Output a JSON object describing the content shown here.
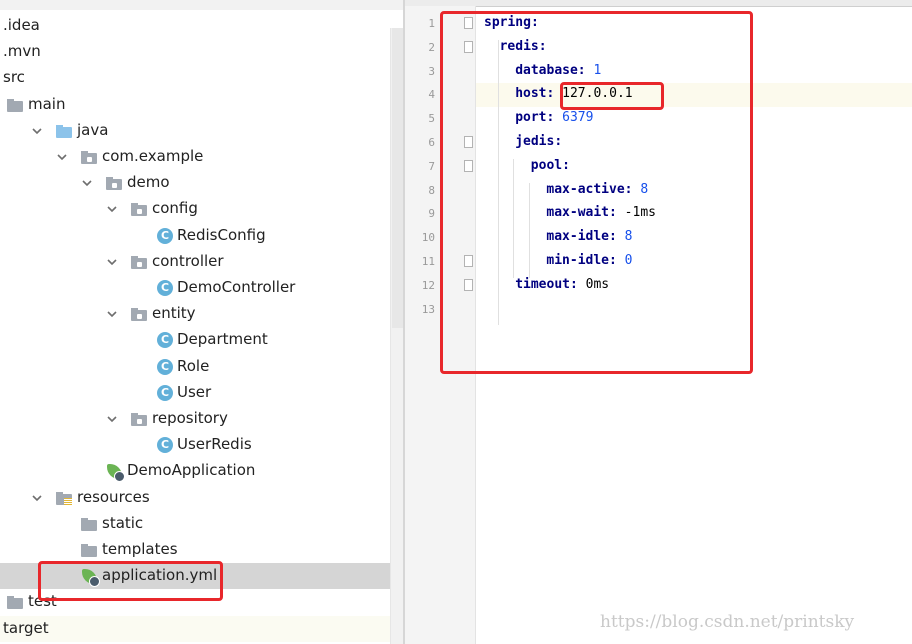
{
  "project_tree": {
    "items": [
      {
        "label": ".idea",
        "indent": 0,
        "icon": "none",
        "arrow": "none"
      },
      {
        "label": ".mvn",
        "indent": 0,
        "icon": "none",
        "arrow": "none"
      },
      {
        "label": "src",
        "indent": 0,
        "icon": "none",
        "arrow": "none"
      },
      {
        "label": "main",
        "indent": 0,
        "icon": "folder",
        "arrow": "none"
      },
      {
        "label": "java",
        "indent": 1,
        "icon": "folder-blue",
        "arrow": "down"
      },
      {
        "label": "com.example",
        "indent": 2,
        "icon": "package",
        "arrow": "down"
      },
      {
        "label": "demo",
        "indent": 3,
        "icon": "package",
        "arrow": "down"
      },
      {
        "label": "config",
        "indent": 4,
        "icon": "package",
        "arrow": "down"
      },
      {
        "label": "RedisConfig",
        "indent": 5,
        "icon": "class",
        "arrow": "none"
      },
      {
        "label": "controller",
        "indent": 4,
        "icon": "package",
        "arrow": "down"
      },
      {
        "label": "DemoController",
        "indent": 5,
        "icon": "class",
        "arrow": "none"
      },
      {
        "label": "entity",
        "indent": 4,
        "icon": "package",
        "arrow": "down"
      },
      {
        "label": "Department",
        "indent": 5,
        "icon": "class",
        "arrow": "none"
      },
      {
        "label": "Role",
        "indent": 5,
        "icon": "class",
        "arrow": "none"
      },
      {
        "label": "User",
        "indent": 5,
        "icon": "class",
        "arrow": "none"
      },
      {
        "label": "repository",
        "indent": 4,
        "icon": "package",
        "arrow": "down"
      },
      {
        "label": "UserRedis",
        "indent": 5,
        "icon": "class",
        "arrow": "none"
      },
      {
        "label": "DemoApplication",
        "indent": 3,
        "icon": "spring-boot",
        "arrow": "none"
      },
      {
        "label": "resources",
        "indent": 1,
        "icon": "resources-folder",
        "arrow": "down"
      },
      {
        "label": "static",
        "indent": 2,
        "icon": "folder",
        "arrow": "none"
      },
      {
        "label": "templates",
        "indent": 2,
        "icon": "folder",
        "arrow": "none"
      },
      {
        "label": "application.yml",
        "indent": 2,
        "icon": "spring-config",
        "arrow": "none",
        "selected": true
      },
      {
        "label": "test",
        "indent": 0,
        "icon": "folder",
        "arrow": "none"
      },
      {
        "label": "target",
        "indent": 0,
        "icon": "none",
        "arrow": "none",
        "hover": true
      }
    ]
  },
  "editor": {
    "current_line": 4,
    "lines": [
      {
        "num": "1",
        "level": 0,
        "key": "spring:",
        "value": "",
        "fold": "open"
      },
      {
        "num": "2",
        "level": 1,
        "key": "redis:",
        "value": "",
        "fold": "open"
      },
      {
        "num": "3",
        "level": 2,
        "key": "database:",
        "value": "1",
        "fold": ""
      },
      {
        "num": "4",
        "level": 2,
        "key": "host:",
        "value": "127.0.0.1",
        "fold": ""
      },
      {
        "num": "5",
        "level": 2,
        "key": "port:",
        "value": "6379",
        "fold": ""
      },
      {
        "num": "6",
        "level": 2,
        "key": "jedis:",
        "value": "",
        "fold": "open"
      },
      {
        "num": "7",
        "level": 3,
        "key": "pool:",
        "value": "",
        "fold": "open"
      },
      {
        "num": "8",
        "level": 4,
        "key": "max-active:",
        "value": "8",
        "fold": ""
      },
      {
        "num": "9",
        "level": 4,
        "key": "max-wait:",
        "value": "-1ms",
        "fold": ""
      },
      {
        "num": "10",
        "level": 4,
        "key": "max-idle:",
        "value": "8",
        "fold": ""
      },
      {
        "num": "11",
        "level": 4,
        "key": "min-idle:",
        "value": "0",
        "fold": "close"
      },
      {
        "num": "12",
        "level": 2,
        "key": "timeout:",
        "value": "0ms",
        "fold": "close"
      },
      {
        "num": "13",
        "level": 0,
        "key": "",
        "value": "",
        "fold": ""
      }
    ]
  },
  "colors": {
    "highlight": "#e8272b",
    "yaml_key": "#000080",
    "yaml_number": "#1750eb"
  },
  "watermark": "https://blog.csdn.net/printsky"
}
